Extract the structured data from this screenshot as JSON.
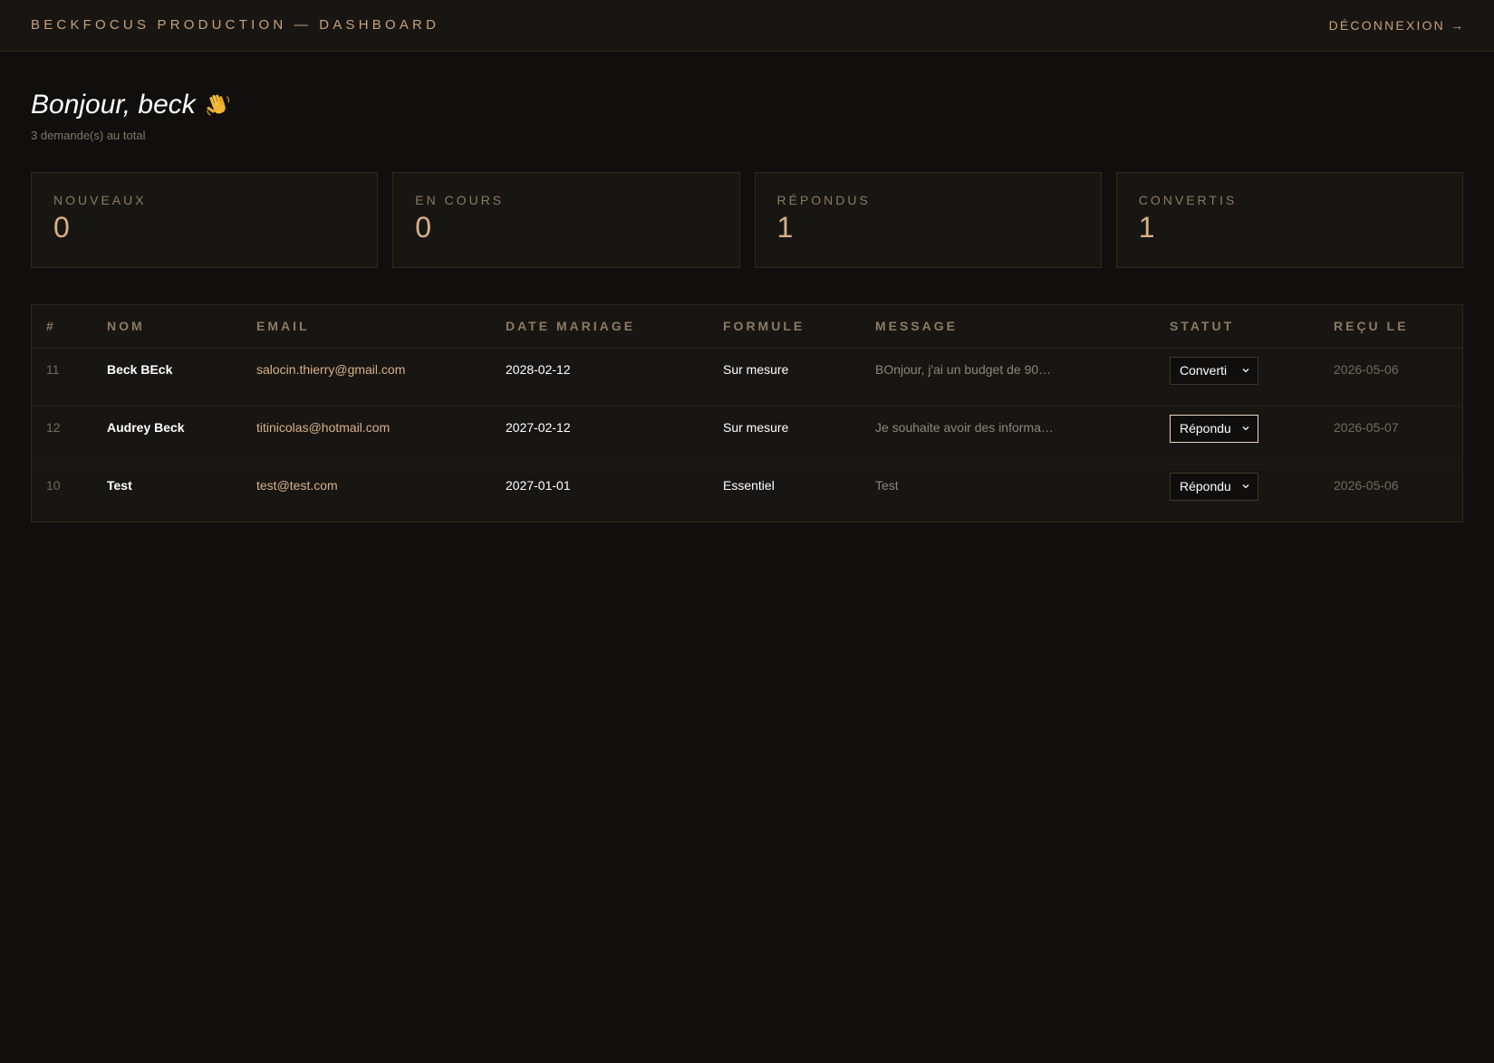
{
  "header": {
    "brand": "BECKFOCUS PRODUCTION — DASHBOARD",
    "logout_label": "DÉCONNEXION",
    "logout_arrow": "→"
  },
  "greeting": {
    "title": "Bonjour, beck",
    "subtitle": "3 demande(s) au total"
  },
  "stats": [
    {
      "label": "NOUVEAUX",
      "value": "0"
    },
    {
      "label": "EN COURS",
      "value": "0"
    },
    {
      "label": "RÉPONDUS",
      "value": "1"
    },
    {
      "label": "CONVERTIS",
      "value": "1"
    }
  ],
  "table": {
    "columns": [
      "#",
      "NOM",
      "EMAIL",
      "DATE MARIAGE",
      "FORMULE",
      "MESSAGE",
      "STATUT",
      "REÇU LE"
    ],
    "rows": [
      {
        "id": "11",
        "name": "Beck BEck",
        "email": "salocin.thierry@gmail.com",
        "date": "2028-02-12",
        "formula": "Sur mesure",
        "message": "BOnjour, j'ai un budget de 90…",
        "status": "Converti",
        "received": "2026-05-06"
      },
      {
        "id": "12",
        "name": "Audrey Beck",
        "email": "titinicolas@hotmail.com",
        "date": "2027-02-12",
        "formula": "Sur mesure",
        "message": "Je souhaite avoir des informa…",
        "status": "Répondu",
        "received": "2026-05-07"
      },
      {
        "id": "10",
        "name": "Test",
        "email": "test@test.com",
        "date": "2027-01-01",
        "formula": "Essentiel",
        "message": "Test",
        "status": "Répondu",
        "received": "2026-05-06"
      }
    ]
  },
  "colors": {
    "background": "#100f0d",
    "panel": "#181612",
    "accent": "#d8b08a",
    "label": "#8c7a62"
  }
}
